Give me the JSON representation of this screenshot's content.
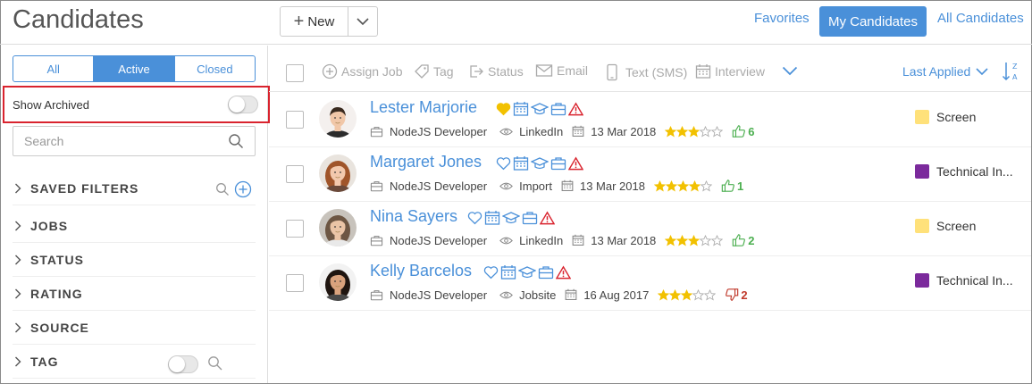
{
  "header": {
    "title": "Candidates",
    "new_label": "New",
    "links": {
      "favorites": "Favorites",
      "my_candidates": "My Candidates",
      "all_candidates": "All Candidates"
    }
  },
  "sidebar": {
    "segments": [
      {
        "label": "All",
        "active": false
      },
      {
        "label": "Active",
        "active": true
      },
      {
        "label": "Closed",
        "active": false
      }
    ],
    "show_archived_label": "Show Archived",
    "search_placeholder": "Search",
    "sections": [
      {
        "label": "SAVED FILTERS"
      },
      {
        "label": "JOBS"
      },
      {
        "label": "STATUS"
      },
      {
        "label": "RATING"
      },
      {
        "label": "SOURCE"
      },
      {
        "label": "TAG"
      }
    ]
  },
  "toolbar": {
    "assign_job": "Assign Job",
    "tag": "Tag",
    "status": "Status",
    "email": "Email",
    "text_sms": "Text (SMS)",
    "interview": "Interview",
    "sort_label": "Last Applied"
  },
  "colors": {
    "accent": "#4a90d9",
    "star": "#f2c100",
    "heart_gold": "#f2c100",
    "alert": "#d9232e",
    "thumb_up": "#4caf50",
    "thumb_down": "#c0392b"
  },
  "candidates": [
    {
      "name": "Lester Marjorie",
      "favorite": true,
      "job": "NodeJS Developer",
      "source": "LinkedIn",
      "date": "13 Mar 2018",
      "rating": 3,
      "vote": "up",
      "score": "6",
      "status": "Screen",
      "status_color": "#ffe17a"
    },
    {
      "name": "Margaret Jones",
      "favorite": false,
      "job": "NodeJS Developer",
      "source": "Import",
      "date": "13 Mar 2018",
      "rating": 4,
      "vote": "up",
      "score": "1",
      "status": "Technical In...",
      "status_color": "#7b2a9c"
    },
    {
      "name": "Nina Sayers",
      "favorite": false,
      "job": "NodeJS Developer",
      "source": "LinkedIn",
      "date": "13 Mar 2018",
      "rating": 3,
      "vote": "up",
      "score": "2",
      "status": "Screen",
      "status_color": "#ffe17a"
    },
    {
      "name": "Kelly Barcelos",
      "favorite": false,
      "job": "NodeJS Developer",
      "source": "Jobsite",
      "date": "16 Aug 2017",
      "rating": 3,
      "vote": "down",
      "score": "2",
      "status": "Technical In...",
      "status_color": "#7b2a9c"
    }
  ]
}
